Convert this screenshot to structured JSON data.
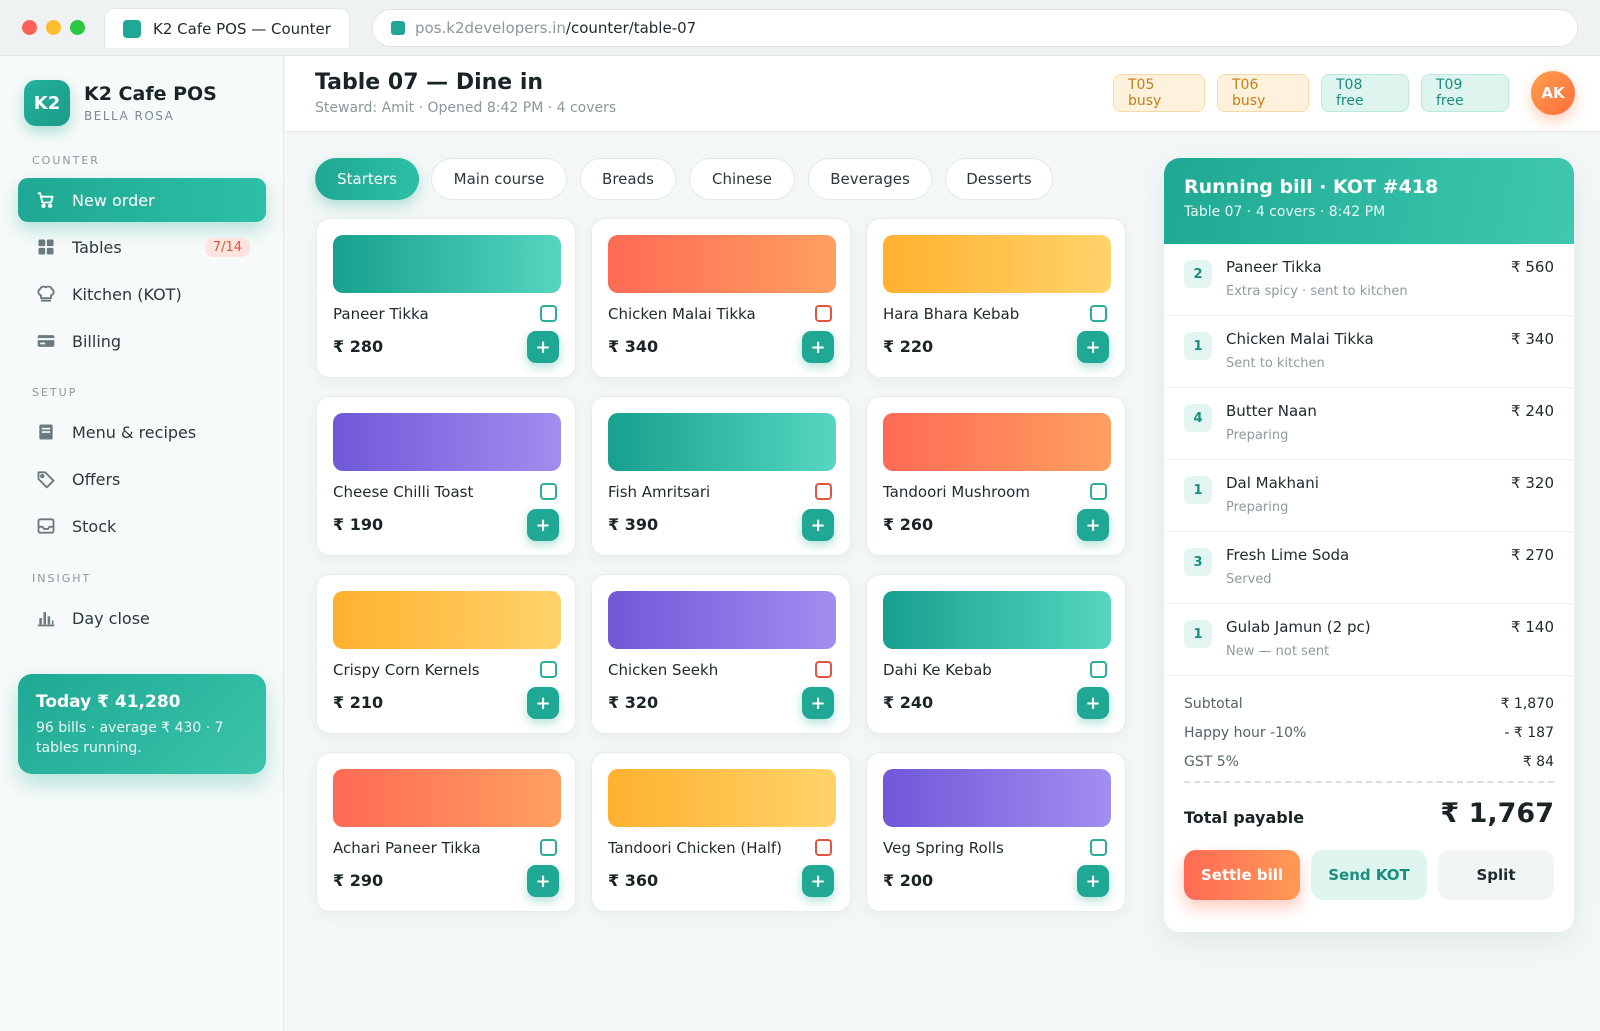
{
  "browser": {
    "tab_title": "K2 Cafe POS — Counter",
    "url_domain": "pos.k2developers.in",
    "url_path": "/counter/table-07"
  },
  "brand": {
    "logo": "K2",
    "name": "K2 Cafe POS",
    "sub": "BELLA ROSA"
  },
  "sidebar": {
    "sections": {
      "counter": "COUNTER",
      "setup": "SETUP",
      "insight": "INSIGHT"
    },
    "items": [
      {
        "label": "New order",
        "icon": "cart-icon"
      },
      {
        "label": "Tables",
        "icon": "grid-icon",
        "badge": "7/14"
      },
      {
        "label": "Kitchen (KOT)",
        "icon": "chef-hat-icon"
      },
      {
        "label": "Billing",
        "icon": "card-icon"
      },
      {
        "label": "Menu & recipes",
        "icon": "book-icon"
      },
      {
        "label": "Offers",
        "icon": "tag-icon"
      },
      {
        "label": "Stock",
        "icon": "inbox-icon"
      },
      {
        "label": "Day close",
        "icon": "bar-chart-icon"
      }
    ],
    "today": {
      "title": "Today ₹ 41,280",
      "sub": "96 bills · average ₹ 430 · 7 tables running."
    }
  },
  "header": {
    "title": "Table 07 — Dine in",
    "sub": "Steward: Amit · Opened 8:42 PM · 4 covers",
    "tables": [
      {
        "label": "T05 busy",
        "status": "busy"
      },
      {
        "label": "T06 busy",
        "status": "busy"
      },
      {
        "label": "T08 free",
        "status": "free"
      },
      {
        "label": "T09 free",
        "status": "free"
      }
    ],
    "avatar": "AK"
  },
  "categories": [
    "Starters",
    "Main course",
    "Breads",
    "Chinese",
    "Beverages",
    "Desserts"
  ],
  "menu": [
    {
      "name": "Paneer Tikka",
      "price": "₹ 280"
    },
    {
      "name": "Chicken Malai Tikka",
      "price": "₹ 340"
    },
    {
      "name": "Hara Bhara Kebab",
      "price": "₹ 220"
    },
    {
      "name": "Cheese Chilli Toast",
      "price": "₹ 190"
    },
    {
      "name": "Fish Amritsari",
      "price": "₹ 390"
    },
    {
      "name": "Tandoori Mushroom",
      "price": "₹ 260"
    },
    {
      "name": "Crispy Corn Kernels",
      "price": "₹ 210"
    },
    {
      "name": "Chicken Seekh",
      "price": "₹ 320"
    },
    {
      "name": "Dahi Ke Kebab",
      "price": "₹ 240"
    },
    {
      "name": "Achari Paneer Tikka",
      "price": "₹ 290"
    },
    {
      "name": "Tandoori Chicken (Half)",
      "price": "₹ 360"
    },
    {
      "name": "Veg Spring Rolls",
      "price": "₹ 200"
    }
  ],
  "add_symbol": "+",
  "bill": {
    "title": "Running bill · KOT #418",
    "sub": "Table 07 · 4 covers · 8:42 PM",
    "items": [
      {
        "qty": "2",
        "name": "Paneer Tikka",
        "note": "Extra spicy · sent to kitchen",
        "price": "₹ 560"
      },
      {
        "qty": "1",
        "name": "Chicken Malai Tikka",
        "note": "Sent to kitchen",
        "price": "₹ 340"
      },
      {
        "qty": "4",
        "name": "Butter Naan",
        "note": "Preparing",
        "price": "₹ 240"
      },
      {
        "qty": "1",
        "name": "Dal Makhani",
        "note": "Preparing",
        "price": "₹ 320"
      },
      {
        "qty": "3",
        "name": "Fresh Lime Soda",
        "note": "Served",
        "price": "₹ 270"
      },
      {
        "qty": "1",
        "name": "Gulab Jamun (2 pc)",
        "note": "New — not sent",
        "price": "₹ 140"
      }
    ],
    "subtotal_label": "Subtotal",
    "subtotal": "₹ 1,870",
    "discount_label": "Happy hour -10%",
    "discount": "- ₹ 187",
    "gst_label": "GST 5%",
    "gst": "₹ 84",
    "total_label": "Total payable",
    "total": "₹ 1,767",
    "buttons": {
      "settle": "Settle bill",
      "kot": "Send KOT",
      "split": "Split"
    }
  },
  "colors": {
    "accent": "#1fa893",
    "coral": "#ff6a55",
    "busy": "#c57f14",
    "free": "#1a8e7c"
  }
}
